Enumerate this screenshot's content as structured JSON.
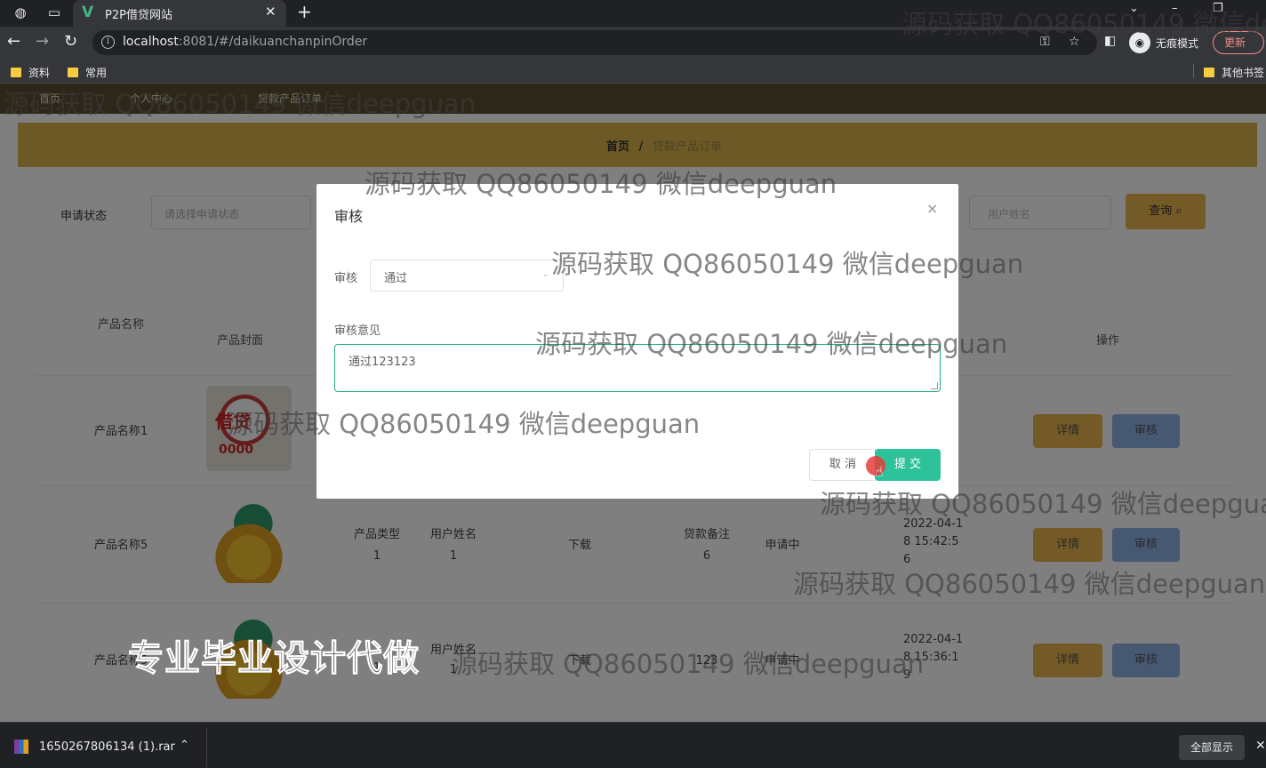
{
  "browser": {
    "tab_title": "P2P借贷网站",
    "url_host": "localhost",
    "url_rest": ":8081/#/daikuanchanpinOrder",
    "incognito_label": "无痕模式",
    "update_label": "更新",
    "bookmarks": [
      "资料",
      "常用"
    ],
    "other_bookmarks": "其他书签"
  },
  "page": {
    "nav_items": [
      "首页",
      "个人中心",
      "贷款产品订单"
    ],
    "breadcrumb_home": "首页",
    "breadcrumb_sep": "/",
    "breadcrumb_current": "贷款产品订单",
    "filter_label": "申请状态",
    "filter_placeholder": "请选择申请状态",
    "user_placeholder": "用户姓名",
    "query_label": "查询 ⌕",
    "headers": {
      "product_name": "产品名称",
      "product_cover": "产品封面",
      "operation": "操作"
    },
    "rows": [
      {
        "name": "产品名称1"
      },
      {
        "name": "产品名称5",
        "type_label": "产品类型",
        "type_value": "1",
        "user_label": "用户姓名",
        "user_value": "1",
        "download": "下载",
        "remark_label": "贷款备注",
        "remark_value": "6",
        "status": "申请中",
        "time": "2022-04-18 15:42:56"
      },
      {
        "name": "产品名称5",
        "type_value": "1",
        "user_label": "用户姓名",
        "user_value": "1",
        "download": "下载",
        "remark_value": "123",
        "status": "申请中",
        "time": "2022-04-18 15:36:19"
      }
    ],
    "detail_label": "详情",
    "audit_label": "审核"
  },
  "dialog": {
    "title": "审核",
    "close": "×",
    "audit_label": "审核",
    "audit_value": "通过",
    "opinion_label": "审核意见",
    "opinion_value": "通过123123",
    "cancel_label": "取 消",
    "submit_label": "提 交"
  },
  "watermark": "源码获取 QQ86050149 微信deepguan",
  "promo": "专业毕业设计代做",
  "download": {
    "filename": "1650267806134 (1).rar",
    "show_all": "全部显示"
  }
}
